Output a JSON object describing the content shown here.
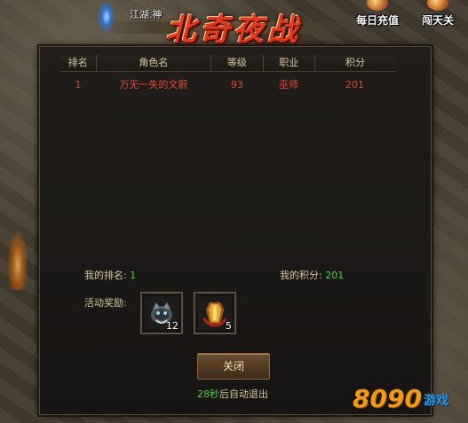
{
  "hud": {
    "player_name": "江湖.神",
    "menu": [
      {
        "label": "每日充值",
        "icon": "coin-orb-icon"
      },
      {
        "label": "闯天关",
        "icon": "gate-orb-icon"
      }
    ]
  },
  "panel": {
    "title": "北奇夜战",
    "table": {
      "headers": [
        "排名",
        "角色名",
        "等级",
        "职业",
        "积分"
      ],
      "rows": [
        [
          "1",
          "万无一失的文蔚",
          "93",
          "巫师",
          "201"
        ]
      ]
    },
    "my_rank_label": "我的排名:",
    "my_rank_value": "1",
    "my_score_label": "我的积分:",
    "my_score_value": "201",
    "rewards_label": "活动奖励:",
    "rewards": [
      {
        "icon": "beast-helmet-icon",
        "count": "12"
      },
      {
        "icon": "golden-armor-icon",
        "count": "5"
      }
    ],
    "close_label": "关闭",
    "countdown_seconds": "28秒",
    "countdown_suffix": "后自动退出"
  },
  "watermark": {
    "number": "8090",
    "text": "游戏"
  },
  "colors": {
    "title_red": "#e03a1c",
    "row_text_red": "#e24a35",
    "value_green": "#4ccf3a",
    "label_tan": "#d8c7a0"
  }
}
